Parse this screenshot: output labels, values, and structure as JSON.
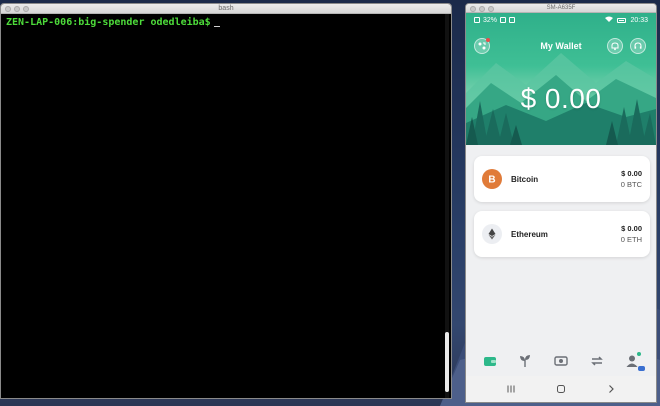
{
  "terminal": {
    "window_title": "bash",
    "prompt": "ZEN-LAP-006:big-spender odedleiba$",
    "prompt_color": "#4ddb3a"
  },
  "phone": {
    "window_title": "SM-A635F",
    "status": {
      "battery": "32%",
      "time": "20:33"
    },
    "header": {
      "title": "My Wallet",
      "balance": "$ 0.00",
      "left_icon": "scan-icon",
      "right_icons": [
        "bell-icon",
        "support-icon"
      ]
    },
    "assets": [
      {
        "name": "Bitcoin",
        "fiat": "$ 0.00",
        "amount": "0 BTC",
        "icon": "bitcoin-icon",
        "color": "#e07b39"
      },
      {
        "name": "Ethereum",
        "fiat": "$ 0.00",
        "amount": "0 ETH",
        "icon": "ethereum-icon",
        "color": "#444444"
      }
    ],
    "bottom_nav": [
      {
        "name": "wallet",
        "icon": "wallet-icon",
        "active": true
      },
      {
        "name": "stake",
        "icon": "plant-icon",
        "active": false
      },
      {
        "name": "buy",
        "icon": "cash-icon",
        "active": false
      },
      {
        "name": "exchange",
        "icon": "swap-icon",
        "active": false
      },
      {
        "name": "profile",
        "icon": "user-icon",
        "active": false
      }
    ],
    "accent_color": "#2db88a"
  }
}
